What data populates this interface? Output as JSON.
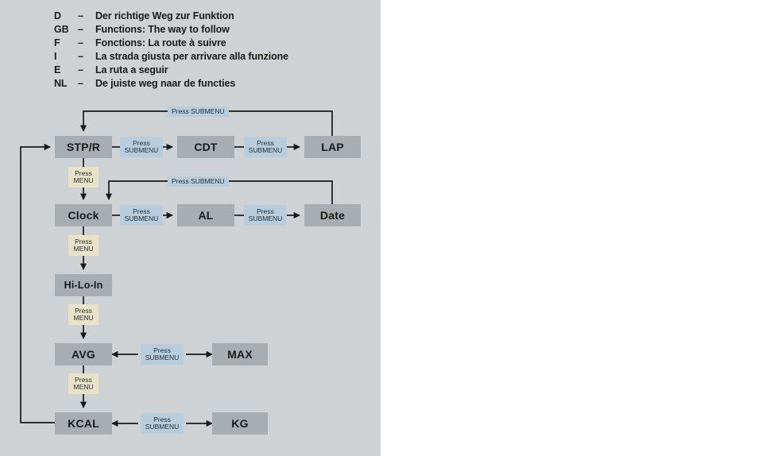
{
  "panel": {
    "background_color": "#ced2d4",
    "node_color": "#a7adb1",
    "submenu_tag_color": "#b7cddd",
    "menu_tag_color": "#e9e2c6",
    "wire_color": "#1a1a1a"
  },
  "legend": {
    "rows": [
      {
        "code": "D",
        "dash": "–",
        "text": "Der richtige Weg zur Funktion"
      },
      {
        "code": "GB",
        "dash": "–",
        "text": "Functions: The way to follow"
      },
      {
        "code": "F",
        "dash": "–",
        "text": "Fonctions: La route à suivre"
      },
      {
        "code": "I",
        "dash": "–",
        "text": "La strada giusta per arrivare alla funzione"
      },
      {
        "code": "E",
        "dash": "–",
        "text": "La ruta a seguir"
      },
      {
        "code": "NL",
        "dash": "–",
        "text": "De juiste weg naar de functies"
      }
    ]
  },
  "diagram": {
    "nodes": [
      {
        "id": "stpr",
        "label": "STP/R"
      },
      {
        "id": "cdt",
        "label": "CDT"
      },
      {
        "id": "lap",
        "label": "LAP"
      },
      {
        "id": "clock",
        "label": "Clock"
      },
      {
        "id": "al",
        "label": "AL"
      },
      {
        "id": "date",
        "label": "Date"
      },
      {
        "id": "hiloin",
        "label": "Hi-Lo-In"
      },
      {
        "id": "avg",
        "label": "AVG"
      },
      {
        "id": "max",
        "label": "MAX"
      },
      {
        "id": "kcal",
        "label": "KCAL"
      },
      {
        "id": "kg",
        "label": "KG"
      }
    ],
    "tags": [
      {
        "id": "loop1",
        "kind": "submenu",
        "line1": "Press SUBMENU",
        "line2": ""
      },
      {
        "id": "stpr-cdt",
        "kind": "submenu",
        "line1": "Press",
        "line2": "SUBMENU"
      },
      {
        "id": "cdt-lap",
        "kind": "submenu",
        "line1": "Press",
        "line2": "SUBMENU"
      },
      {
        "id": "stpr-clock",
        "kind": "menu",
        "line1": "Press",
        "line2": "MENU"
      },
      {
        "id": "loop2",
        "kind": "submenu",
        "line1": "Press SUBMENU",
        "line2": ""
      },
      {
        "id": "clock-al",
        "kind": "submenu",
        "line1": "Press",
        "line2": "SUBMENU"
      },
      {
        "id": "al-date",
        "kind": "submenu",
        "line1": "Press",
        "line2": "SUBMENU"
      },
      {
        "id": "clock-hiloin",
        "kind": "menu",
        "line1": "Press",
        "line2": "MENU"
      },
      {
        "id": "hiloin-avg",
        "kind": "menu",
        "line1": "Press",
        "line2": "MENU"
      },
      {
        "id": "avg-max",
        "kind": "submenu",
        "line1": "Press",
        "line2": "SUBMENU"
      },
      {
        "id": "avg-kcal",
        "kind": "menu",
        "line1": "Press",
        "line2": "MENU"
      },
      {
        "id": "kcal-kg",
        "kind": "submenu",
        "line1": "Press",
        "line2": "SUBMENU"
      }
    ]
  }
}
